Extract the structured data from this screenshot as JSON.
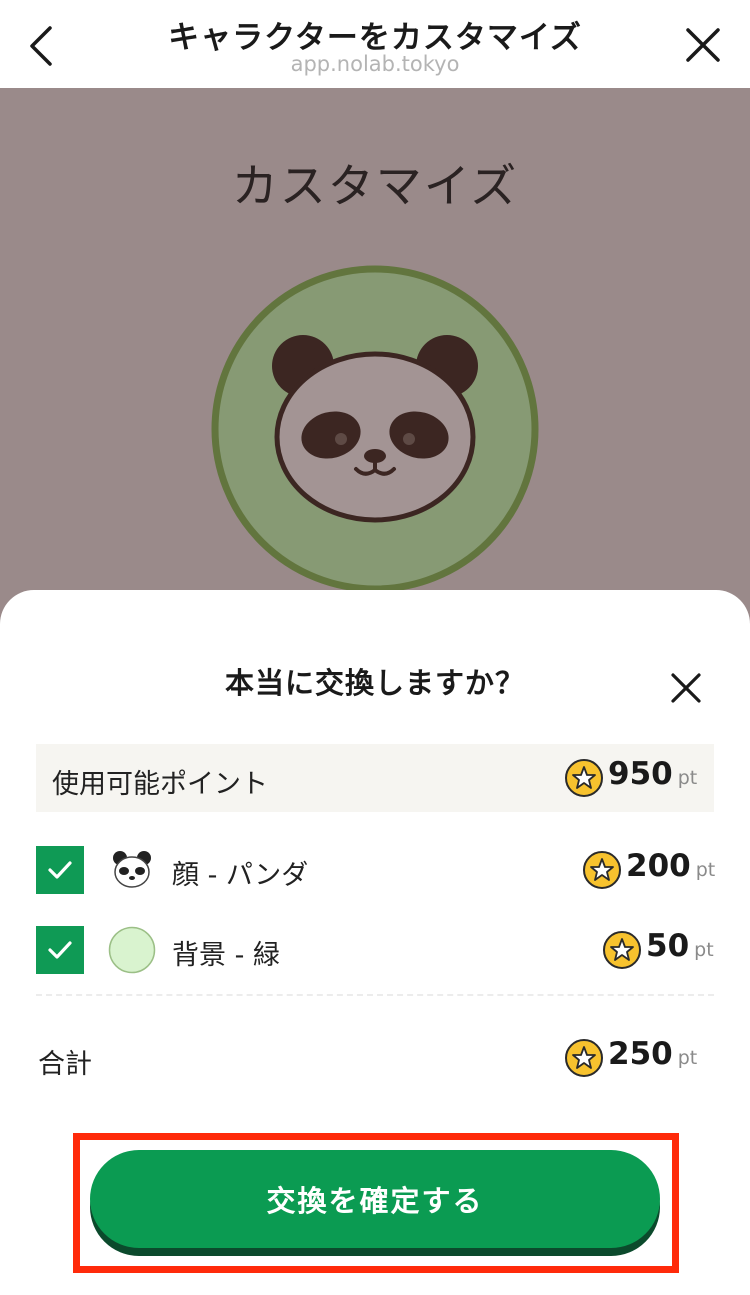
{
  "header": {
    "title": "キャラクターをカスタマイズ",
    "url": "app.nolab.tokyo"
  },
  "background": {
    "title": "カスタマイズ"
  },
  "dialog": {
    "title": "本当に交換しますか？",
    "available": {
      "label": "使用可能ポイント",
      "points": "950",
      "unit": "pt"
    },
    "items": [
      {
        "label": "顔 - パンダ",
        "points": "200",
        "unit": "pt",
        "checked": true,
        "thumb": "panda-icon"
      },
      {
        "label": "背景 - 緑",
        "points": "50",
        "unit": "pt",
        "checked": true,
        "thumb": "green-circle"
      }
    ],
    "total": {
      "label": "合計",
      "points": "250",
      "unit": "pt"
    },
    "confirm_label": "交換を確定する"
  },
  "colors": {
    "accent_green": "#0b9b52",
    "highlight_red": "#ff2a0a",
    "coin_yellow": "#f7c22e"
  }
}
